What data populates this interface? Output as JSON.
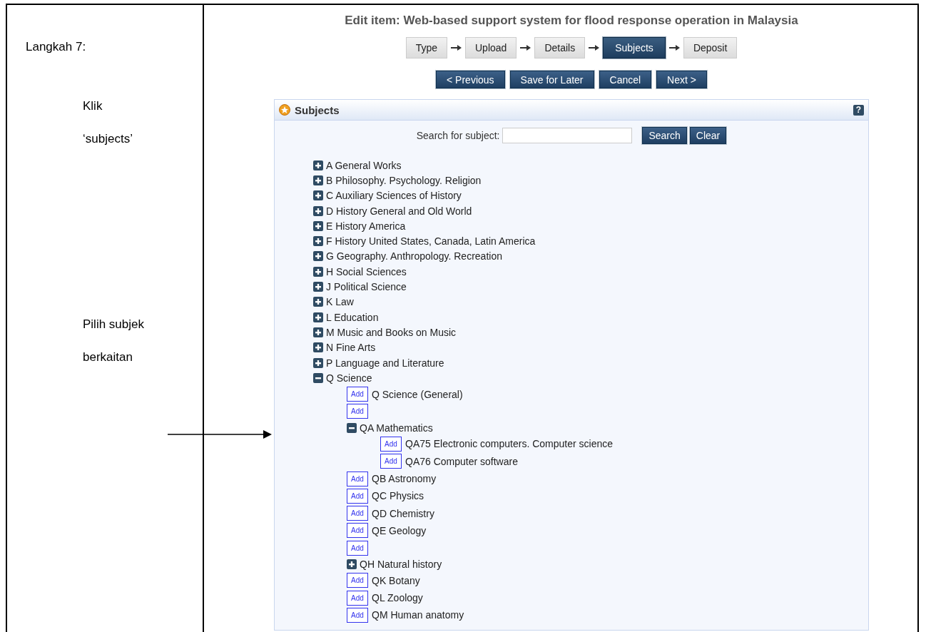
{
  "instructions": {
    "step": "Langkah 7:",
    "notes": [
      {
        "lines": [
          "Klik",
          "‘subjects’"
        ]
      },
      {
        "lines": [
          "Pilih subjek",
          "berkaitan"
        ]
      }
    ]
  },
  "screenshot": {
    "title": "Edit item: Web-based support system for flood response operation in Malaysia",
    "steps": [
      {
        "label": "Type",
        "selected": false
      },
      {
        "label": "Upload",
        "selected": false
      },
      {
        "label": "Details",
        "selected": false
      },
      {
        "label": "Subjects",
        "selected": true
      },
      {
        "label": "Deposit",
        "selected": false
      }
    ],
    "buttons": [
      "< Previous",
      "Save for Later",
      "Cancel",
      "Next >"
    ],
    "panel": {
      "title": "Subjects",
      "help": "?",
      "search": {
        "label": "Search for subject:",
        "buttons": [
          "Search",
          "Clear"
        ]
      },
      "tree": [
        {
          "kind": "branch",
          "label": "A General Works",
          "expanded": false
        },
        {
          "kind": "branch",
          "label": "B Philosophy. Psychology. Religion",
          "expanded": false
        },
        {
          "kind": "branch",
          "label": "C Auxiliary Sciences of History",
          "expanded": false
        },
        {
          "kind": "branch",
          "label": "D History General and Old World",
          "expanded": false
        },
        {
          "kind": "branch",
          "label": "E History America",
          "expanded": false
        },
        {
          "kind": "branch",
          "label": "F History United States, Canada, Latin America",
          "expanded": false
        },
        {
          "kind": "branch",
          "label": "G Geography. Anthropology. Recreation",
          "expanded": false
        },
        {
          "kind": "branch",
          "label": "H Social Sciences",
          "expanded": false
        },
        {
          "kind": "branch",
          "label": "J Political Science",
          "expanded": false
        },
        {
          "kind": "branch",
          "label": "K Law",
          "expanded": false
        },
        {
          "kind": "branch",
          "label": "L Education",
          "expanded": false
        },
        {
          "kind": "branch",
          "label": "M Music and Books on Music",
          "expanded": false
        },
        {
          "kind": "branch",
          "label": "N Fine Arts",
          "expanded": false
        },
        {
          "kind": "branch",
          "label": "P Language and Literature",
          "expanded": false
        },
        {
          "kind": "branch",
          "label": "Q Science",
          "expanded": true,
          "children": [
            {
              "kind": "leaf",
              "button": "Add",
              "label": "Q Science (General)"
            },
            {
              "kind": "leaf",
              "button": "Add"
            },
            {
              "kind": "branch",
              "label": "QA Mathematics",
              "expanded": true,
              "children": [
                {
                  "kind": "leaf",
                  "button": "Add",
                  "label": "QA75 Electronic computers. Computer science"
                },
                {
                  "kind": "leaf",
                  "button": "Add",
                  "label": "QA76 Computer software"
                }
              ]
            },
            {
              "kind": "leaf",
              "button": "Add",
              "label": "QB Astronomy"
            },
            {
              "kind": "leaf",
              "button": "Add",
              "label": "QC Physics"
            },
            {
              "kind": "leaf",
              "button": "Add",
              "label": "QD Chemistry"
            },
            {
              "kind": "leaf",
              "button": "Add",
              "label": "QE Geology"
            },
            {
              "kind": "leaf",
              "button": "Add"
            },
            {
              "kind": "branch",
              "label": "QH Natural history",
              "expanded": false
            },
            {
              "kind": "leaf",
              "button": "Add",
              "label": "QK Botany"
            },
            {
              "kind": "leaf",
              "button": "Add",
              "label": "QL Zoology"
            },
            {
              "kind": "leaf",
              "button": "Add",
              "label": "QM Human anatomy"
            }
          ]
        }
      ]
    }
  }
}
